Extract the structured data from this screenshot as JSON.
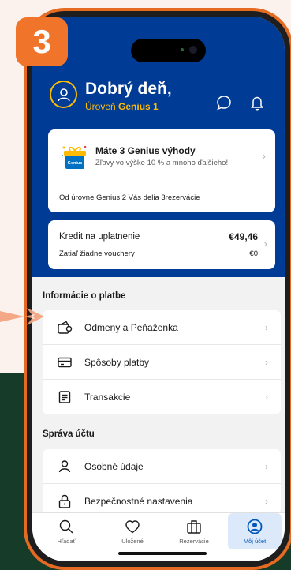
{
  "step": {
    "number": "3",
    "color": "#f0752a"
  },
  "header": {
    "greeting": "Dobrý deň,",
    "level_prefix": "Úroveň",
    "level_name": "Genius 1",
    "icons": [
      "user-icon",
      "chat-icon",
      "bell-icon"
    ],
    "background": "#003b95",
    "accent": "#febb02"
  },
  "genius_card": {
    "badge": "Genius",
    "title": "Máte 3 Genius výhody",
    "subtitle": "Zľavy vo výške 10 % a mnoho ďalšieho!",
    "footer": "Od úrovne Genius 2 Vás delia 3rezervácie"
  },
  "credit_card": {
    "label": "Kredit na uplatnenie",
    "value": "€49,46",
    "vouchers_label": "Zatiaľ žiadne vouchery",
    "vouchers_value": "€0"
  },
  "payment_section": {
    "title": "Informácie o platbe",
    "items": [
      {
        "label": "Odmeny a Peňaženka",
        "icon": "wallet-icon"
      },
      {
        "label": "Spôsoby platby",
        "icon": "card-icon"
      },
      {
        "label": "Transakcie",
        "icon": "receipt-icon"
      }
    ]
  },
  "account_section": {
    "title": "Správa účtu",
    "items": [
      {
        "label": "Osobné údaje",
        "icon": "person-icon"
      },
      {
        "label": "Bezpečnostné nastavenia",
        "icon": "lock-icon"
      }
    ]
  },
  "tabbar": {
    "tabs": [
      {
        "label": "Hľadať",
        "icon": "search-icon"
      },
      {
        "label": "Uložené",
        "icon": "heart-icon"
      },
      {
        "label": "Rezervácie",
        "icon": "suitcase-icon"
      },
      {
        "label": "Môj účet",
        "icon": "account-icon",
        "active": true
      }
    ]
  }
}
